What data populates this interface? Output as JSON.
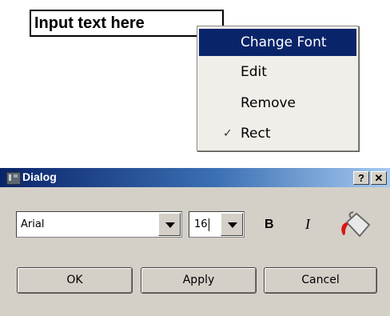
{
  "textbox": {
    "text": "Input text here"
  },
  "context_menu": {
    "items": [
      {
        "label": "Change Font",
        "highlighted": true
      },
      {
        "label": "Edit"
      },
      {
        "label": "Remove"
      },
      {
        "label": "Rect",
        "checked": true
      }
    ]
  },
  "dialog": {
    "title": "Dialog",
    "help_label": "?",
    "close_label": "✕",
    "font": {
      "value": "Arial"
    },
    "size": {
      "value": "16"
    },
    "bold_label": "B",
    "italic_label": "I",
    "color_icon": "paint-bucket-icon",
    "buttons": {
      "ok": "OK",
      "apply": "Apply",
      "cancel": "Cancel"
    }
  },
  "colors": {
    "menu_highlight": "#0a246a",
    "dialog_bg": "#d4d0c8",
    "paint_red": "#d91515"
  }
}
